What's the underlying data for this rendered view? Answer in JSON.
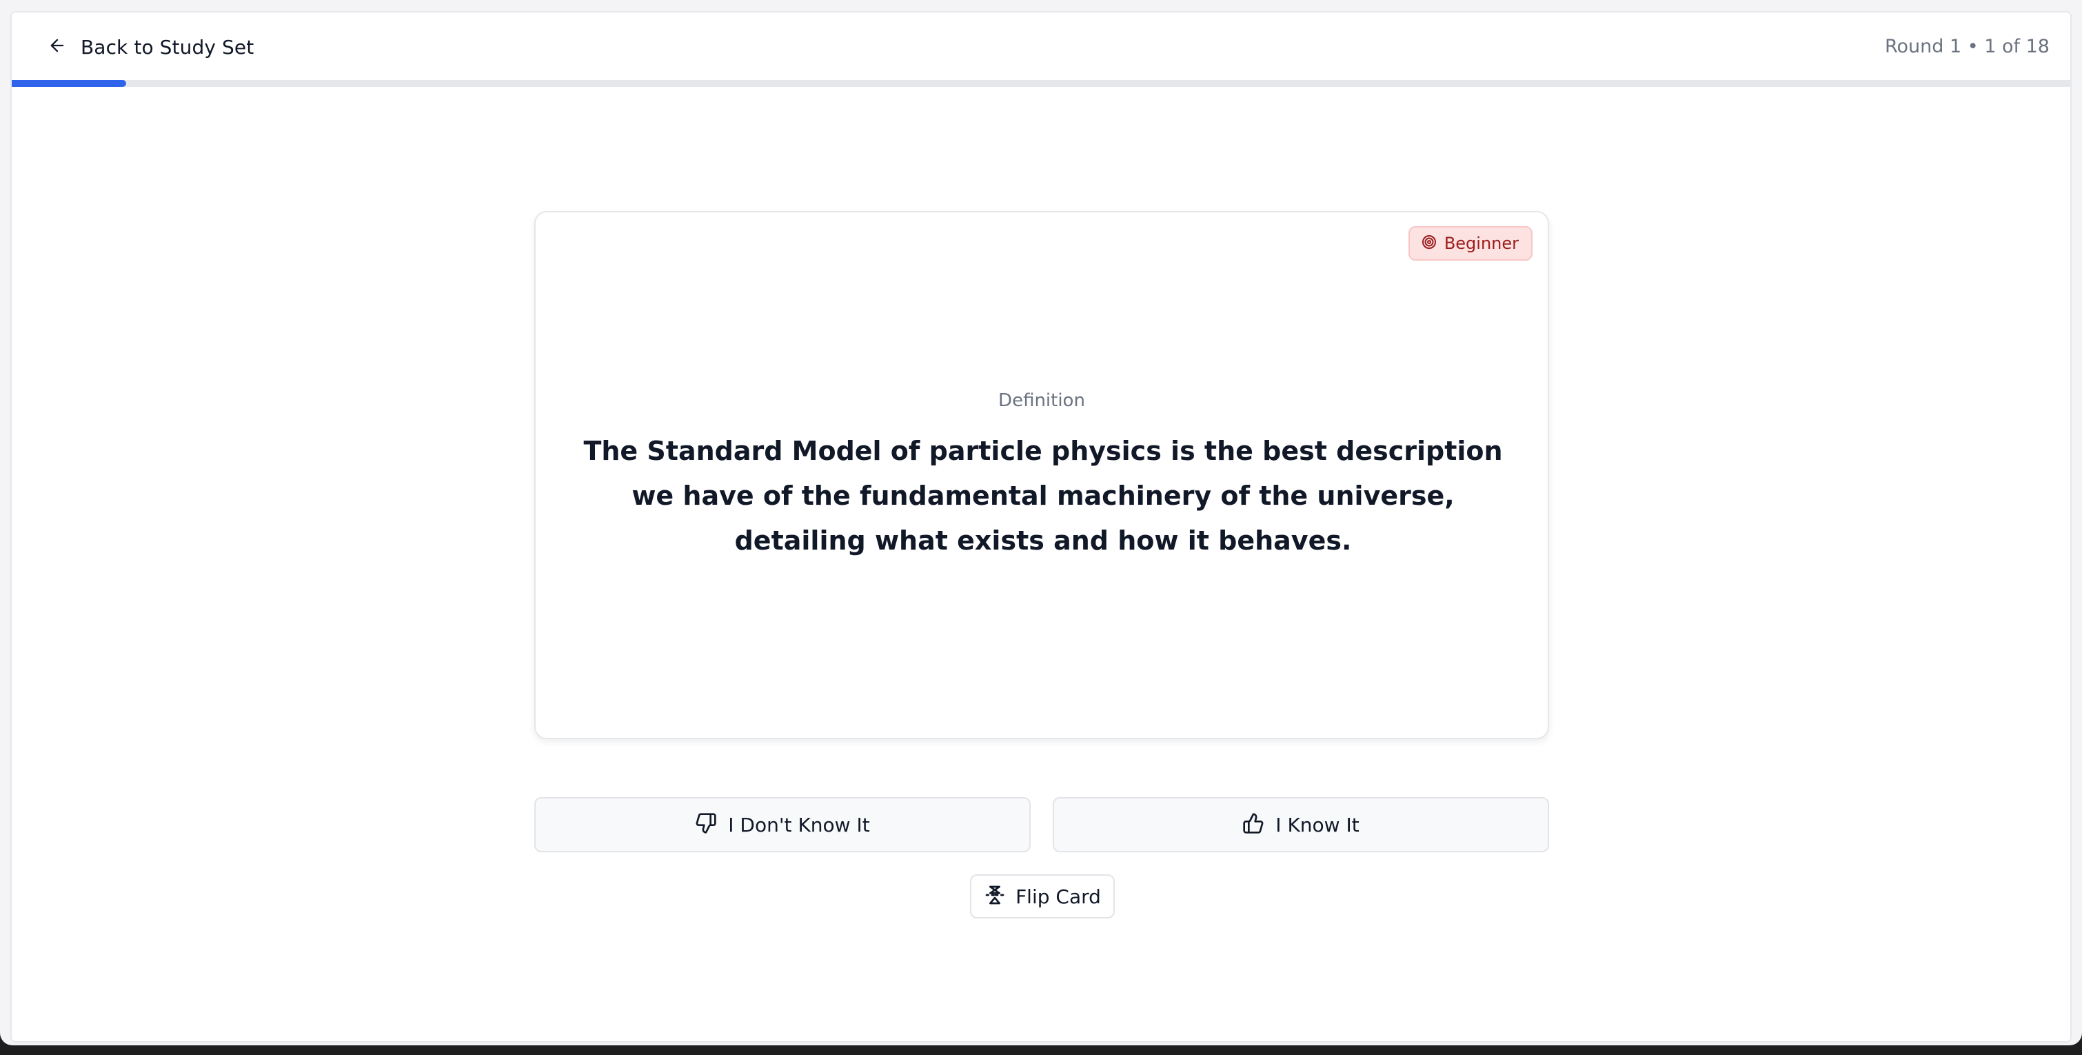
{
  "header": {
    "back_label": "Back to Study Set",
    "round_info": "Round 1 • 1 of 18"
  },
  "progress": {
    "current": 1,
    "total": 18,
    "fraction": 0.0556,
    "color": "#2f63eb"
  },
  "card": {
    "level_badge": "Beginner",
    "level_icon": "target-icon",
    "side_label": "Definition",
    "text": "The Standard Model of particle physics is the best description we have of the fundamental machinery of the universe, detailing what exists and how it behaves."
  },
  "actions": {
    "dont_know_label": "I Don't Know It",
    "dont_know_icon": "thumbs-down-icon",
    "know_label": "I Know It",
    "know_icon": "thumbs-up-icon",
    "flip_label": "Flip Card",
    "flip_icon": "flip-vertical-icon"
  },
  "colors": {
    "accent": "#2f63eb",
    "badge_bg": "#fde2e2",
    "badge_text": "#9b1c1c",
    "text_primary": "#111827",
    "text_muted": "#6b7280"
  }
}
